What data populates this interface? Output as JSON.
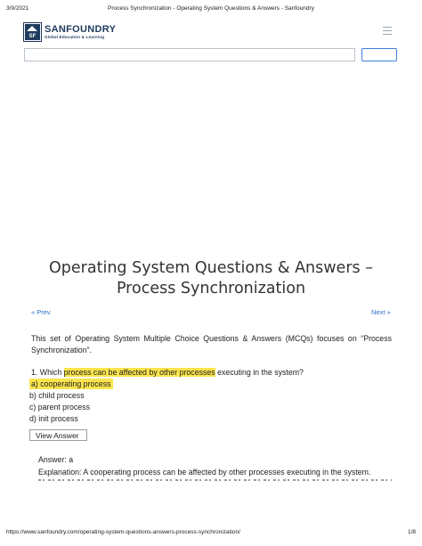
{
  "print_header": {
    "date": "3/9/2021",
    "title": "Process Synchronization - Operating System Questions & Answers - Sanfoundry"
  },
  "logo": {
    "mark_text": "SF",
    "name": "SANFOUNDRY",
    "tagline": "Global Education & Learning"
  },
  "search": {
    "placeholder": "",
    "button_label": ""
  },
  "article": {
    "title_line1": "Operating System Questions & Answers –",
    "title_line2": "Process Synchronization",
    "prev_label": "« Prev",
    "next_label": "Next »",
    "intro": "This set of Operating System Multiple Choice Questions & Answers (MCQs) focuses on “Process Synchronization”.",
    "question": {
      "prefix": "1. Which ",
      "highlight": "process can be affected by other processes",
      "suffix": " executing in the system?",
      "options": [
        "a) cooperating process",
        "b) child process",
        "c) parent process",
        "d) init process"
      ],
      "view_answer_label": "View Answer",
      "answer": "Answer: a",
      "explanation": "Explanation: A cooperating process can be affected by other processes executing in the system."
    }
  },
  "print_footer": {
    "url": "https://www.sanfoundry.com/operating-system-questions-answers-process-synchronization/",
    "page": "1/8"
  },
  "colors": {
    "brand": "#1f3b5e",
    "link": "#2a6fc9",
    "highlight": "#fbe44d",
    "search_button_border": "#3b7fd9"
  }
}
